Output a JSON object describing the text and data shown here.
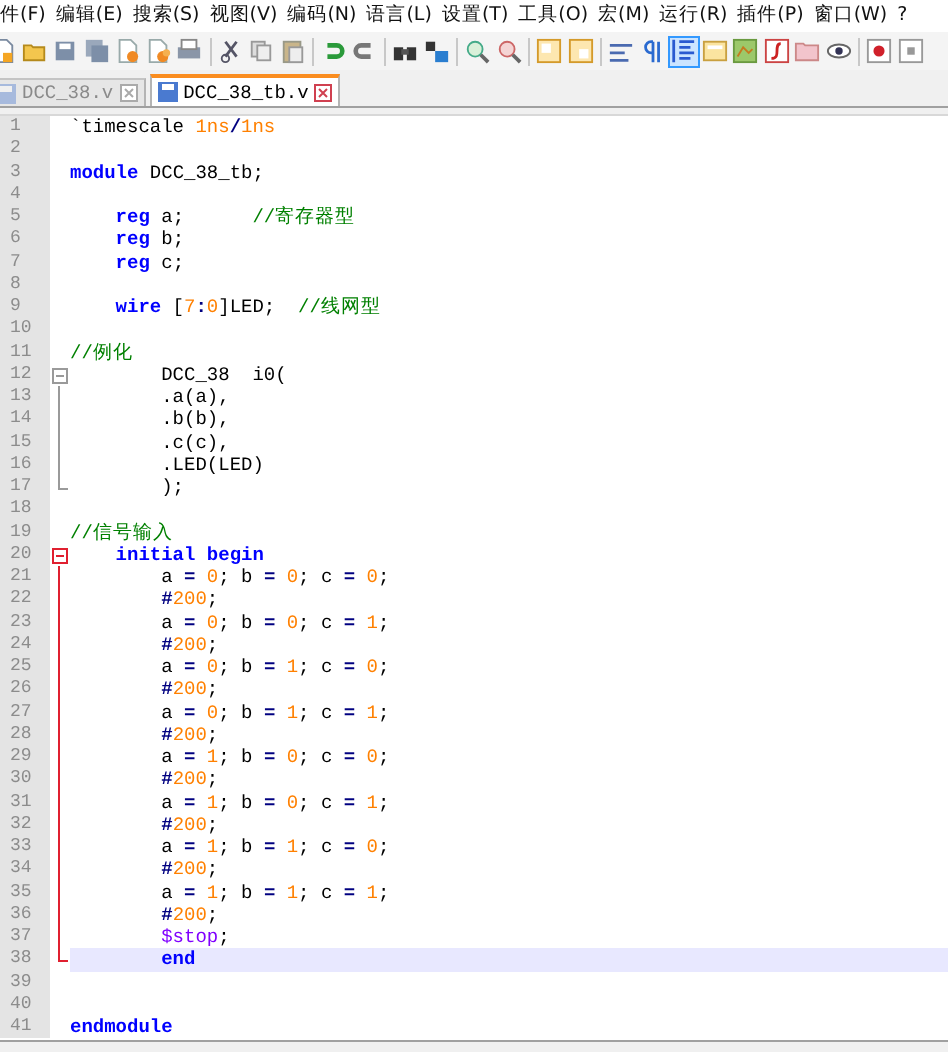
{
  "menu": [
    {
      "label": "件(F)"
    },
    {
      "label": "编辑(E)"
    },
    {
      "label": "搜索(S)"
    },
    {
      "label": "视图(V)"
    },
    {
      "label": "编码(N)"
    },
    {
      "label": "语言(L)"
    },
    {
      "label": "设置(T)"
    },
    {
      "label": "工具(O)"
    },
    {
      "label": "宏(M)"
    },
    {
      "label": "运行(R)"
    },
    {
      "label": "插件(P)"
    },
    {
      "label": "窗口(W)"
    },
    {
      "label": "?"
    }
  ],
  "toolbar": [
    {
      "kind": "new",
      "pressed": false
    },
    {
      "kind": "open",
      "pressed": false
    },
    {
      "kind": "save",
      "pressed": false
    },
    {
      "kind": "saveall",
      "pressed": false
    },
    {
      "kind": "close",
      "pressed": false
    },
    {
      "kind": "closeall",
      "pressed": false
    },
    {
      "kind": "print",
      "pressed": false
    },
    {
      "kind": "sep"
    },
    {
      "kind": "cut",
      "pressed": false
    },
    {
      "kind": "copy",
      "pressed": false
    },
    {
      "kind": "paste",
      "pressed": false
    },
    {
      "kind": "sep"
    },
    {
      "kind": "undo",
      "pressed": false
    },
    {
      "kind": "redo",
      "pressed": false
    },
    {
      "kind": "sep"
    },
    {
      "kind": "find",
      "pressed": false
    },
    {
      "kind": "replace",
      "pressed": false
    },
    {
      "kind": "sep"
    },
    {
      "kind": "zoomin",
      "pressed": false
    },
    {
      "kind": "zoomout",
      "pressed": false
    },
    {
      "kind": "sep"
    },
    {
      "kind": "syncv",
      "pressed": false
    },
    {
      "kind": "synch",
      "pressed": false
    },
    {
      "kind": "sep"
    },
    {
      "kind": "wrap",
      "pressed": false
    },
    {
      "kind": "pilcrow",
      "pressed": false
    },
    {
      "kind": "guide",
      "pressed": true
    },
    {
      "kind": "panel",
      "pressed": false
    },
    {
      "kind": "map",
      "pressed": false
    },
    {
      "kind": "function",
      "pressed": false
    },
    {
      "kind": "folder",
      "pressed": false
    },
    {
      "kind": "eye",
      "pressed": false
    },
    {
      "kind": "sep"
    },
    {
      "kind": "record",
      "pressed": false
    },
    {
      "kind": "stop",
      "pressed": false
    }
  ],
  "tabs": [
    {
      "label": "DCC_38.v",
      "selected": false
    },
    {
      "label": "DCC_38_tb.v",
      "selected": true
    }
  ],
  "editor": {
    "lines": [
      {
        "number": "1",
        "current": false,
        "tokens": [
          {
            "text": "`timescale ",
            "kind": "plain"
          },
          {
            "text": "1ns",
            "kind": "number"
          },
          {
            "text": "/",
            "kind": "operator"
          },
          {
            "text": "1ns",
            "kind": "number"
          }
        ]
      },
      {
        "number": "2",
        "current": false
      },
      {
        "number": "3",
        "current": false,
        "tokens": [
          {
            "text": "module",
            "kind": "keyword"
          },
          {
            "text": " DCC_38_tb;",
            "kind": "plain"
          }
        ]
      },
      {
        "number": "4",
        "current": false
      },
      {
        "number": "5",
        "current": false,
        "tokens": [
          {
            "text": "    reg",
            "kind": "keyword"
          },
          {
            "text": " a;      ",
            "kind": "plain"
          },
          {
            "text": "//寄存器型",
            "kind": "comment"
          }
        ]
      },
      {
        "number": "6",
        "current": false,
        "tokens": [
          {
            "text": "    reg",
            "kind": "keyword"
          },
          {
            "text": " b;",
            "kind": "plain"
          }
        ]
      },
      {
        "number": "7",
        "current": false,
        "tokens": [
          {
            "text": "    reg",
            "kind": "keyword"
          },
          {
            "text": " c;",
            "kind": "plain"
          }
        ]
      },
      {
        "number": "8",
        "current": false
      },
      {
        "number": "9",
        "current": false,
        "tokens": [
          {
            "text": "    wire",
            "kind": "keyword"
          },
          {
            "text": " [",
            "kind": "plain"
          },
          {
            "text": "7",
            "kind": "number"
          },
          {
            "text": ":",
            "kind": "operator"
          },
          {
            "text": "0",
            "kind": "number"
          },
          {
            "text": "]LED;  ",
            "kind": "plain"
          },
          {
            "text": "//线网型",
            "kind": "comment"
          }
        ]
      },
      {
        "number": "10",
        "current": false
      },
      {
        "number": "11",
        "current": false,
        "tokens": [
          {
            "text": "//例化",
            "kind": "comment"
          }
        ]
      },
      {
        "number": "12",
        "current": false,
        "fold": {
          "kind": "open",
          "active": false
        },
        "tokens": [
          {
            "text": "        DCC_38  i0(",
            "kind": "plain"
          }
        ]
      },
      {
        "number": "13",
        "current": false,
        "fold": {
          "kind": "body",
          "active": false
        },
        "tokens": [
          {
            "text": "        .a(a),",
            "kind": "plain"
          }
        ]
      },
      {
        "number": "14",
        "current": false,
        "fold": {
          "kind": "body",
          "active": false
        },
        "tokens": [
          {
            "text": "        .b(b),",
            "kind": "plain"
          }
        ]
      },
      {
        "number": "15",
        "current": false,
        "fold": {
          "kind": "body",
          "active": false
        },
        "tokens": [
          {
            "text": "        .c(c),",
            "kind": "plain"
          }
        ]
      },
      {
        "number": "16",
        "current": false,
        "fold": {
          "kind": "body",
          "active": false
        },
        "tokens": [
          {
            "text": "        .LED(LED)",
            "kind": "plain"
          }
        ]
      },
      {
        "number": "17",
        "current": false,
        "fold": {
          "kind": "end",
          "active": false
        },
        "tokens": [
          {
            "text": "        );",
            "kind": "plain"
          }
        ]
      },
      {
        "number": "18",
        "current": false
      },
      {
        "number": "19",
        "current": false,
        "tokens": [
          {
            "text": "//信号输入",
            "kind": "comment"
          }
        ]
      },
      {
        "number": "20",
        "current": false,
        "fold": {
          "kind": "open",
          "active": true
        },
        "tokens": [
          {
            "text": "    initial begin",
            "kind": "keyword"
          }
        ]
      },
      {
        "number": "21",
        "current": false,
        "fold": {
          "kind": "body",
          "active": true
        },
        "tokens": [
          {
            "text": "        a ",
            "kind": "plain"
          },
          {
            "text": "=",
            "kind": "operator"
          },
          {
            "text": " 0",
            "kind": "number"
          },
          {
            "text": "; b ",
            "kind": "plain"
          },
          {
            "text": "=",
            "kind": "operator"
          },
          {
            "text": " 0",
            "kind": "number"
          },
          {
            "text": "; c ",
            "kind": "plain"
          },
          {
            "text": "=",
            "kind": "operator"
          },
          {
            "text": " 0",
            "kind": "number"
          },
          {
            "text": ";",
            "kind": "plain"
          }
        ]
      },
      {
        "number": "22",
        "current": false,
        "fold": {
          "kind": "body",
          "active": true
        },
        "tokens": [
          {
            "text": "        #",
            "kind": "operator"
          },
          {
            "text": "200",
            "kind": "number"
          },
          {
            "text": ";",
            "kind": "plain"
          }
        ]
      },
      {
        "number": "23",
        "current": false,
        "fold": {
          "kind": "body",
          "active": true
        },
        "tokens": [
          {
            "text": "        a ",
            "kind": "plain"
          },
          {
            "text": "=",
            "kind": "operator"
          },
          {
            "text": " 0",
            "kind": "number"
          },
          {
            "text": "; b ",
            "kind": "plain"
          },
          {
            "text": "=",
            "kind": "operator"
          },
          {
            "text": " 0",
            "kind": "number"
          },
          {
            "text": "; c ",
            "kind": "plain"
          },
          {
            "text": "=",
            "kind": "operator"
          },
          {
            "text": " 1",
            "kind": "number"
          },
          {
            "text": ";",
            "kind": "plain"
          }
        ]
      },
      {
        "number": "24",
        "current": false,
        "fold": {
          "kind": "body",
          "active": true
        },
        "tokens": [
          {
            "text": "        #",
            "kind": "operator"
          },
          {
            "text": "200",
            "kind": "number"
          },
          {
            "text": ";",
            "kind": "plain"
          }
        ]
      },
      {
        "number": "25",
        "current": false,
        "fold": {
          "kind": "body",
          "active": true
        },
        "tokens": [
          {
            "text": "        a ",
            "kind": "plain"
          },
          {
            "text": "=",
            "kind": "operator"
          },
          {
            "text": " 0",
            "kind": "number"
          },
          {
            "text": "; b ",
            "kind": "plain"
          },
          {
            "text": "=",
            "kind": "operator"
          },
          {
            "text": " 1",
            "kind": "number"
          },
          {
            "text": "; c ",
            "kind": "plain"
          },
          {
            "text": "=",
            "kind": "operator"
          },
          {
            "text": " 0",
            "kind": "number"
          },
          {
            "text": ";",
            "kind": "plain"
          }
        ]
      },
      {
        "number": "26",
        "current": false,
        "fold": {
          "kind": "body",
          "active": true
        },
        "tokens": [
          {
            "text": "        #",
            "kind": "operator"
          },
          {
            "text": "200",
            "kind": "number"
          },
          {
            "text": ";",
            "kind": "plain"
          }
        ]
      },
      {
        "number": "27",
        "current": false,
        "fold": {
          "kind": "body",
          "active": true
        },
        "tokens": [
          {
            "text": "        a ",
            "kind": "plain"
          },
          {
            "text": "=",
            "kind": "operator"
          },
          {
            "text": " 0",
            "kind": "number"
          },
          {
            "text": "; b ",
            "kind": "plain"
          },
          {
            "text": "=",
            "kind": "operator"
          },
          {
            "text": " 1",
            "kind": "number"
          },
          {
            "text": "; c ",
            "kind": "plain"
          },
          {
            "text": "=",
            "kind": "operator"
          },
          {
            "text": " 1",
            "kind": "number"
          },
          {
            "text": ";",
            "kind": "plain"
          }
        ]
      },
      {
        "number": "28",
        "current": false,
        "fold": {
          "kind": "body",
          "active": true
        },
        "tokens": [
          {
            "text": "        #",
            "kind": "operator"
          },
          {
            "text": "200",
            "kind": "number"
          },
          {
            "text": ";",
            "kind": "plain"
          }
        ]
      },
      {
        "number": "29",
        "current": false,
        "fold": {
          "kind": "body",
          "active": true
        },
        "tokens": [
          {
            "text": "        a ",
            "kind": "plain"
          },
          {
            "text": "=",
            "kind": "operator"
          },
          {
            "text": " 1",
            "kind": "number"
          },
          {
            "text": "; b ",
            "kind": "plain"
          },
          {
            "text": "=",
            "kind": "operator"
          },
          {
            "text": " 0",
            "kind": "number"
          },
          {
            "text": "; c ",
            "kind": "plain"
          },
          {
            "text": "=",
            "kind": "operator"
          },
          {
            "text": " 0",
            "kind": "number"
          },
          {
            "text": ";",
            "kind": "plain"
          }
        ]
      },
      {
        "number": "30",
        "current": false,
        "fold": {
          "kind": "body",
          "active": true
        },
        "tokens": [
          {
            "text": "        #",
            "kind": "operator"
          },
          {
            "text": "200",
            "kind": "number"
          },
          {
            "text": ";",
            "kind": "plain"
          }
        ]
      },
      {
        "number": "31",
        "current": false,
        "fold": {
          "kind": "body",
          "active": true
        },
        "tokens": [
          {
            "text": "        a ",
            "kind": "plain"
          },
          {
            "text": "=",
            "kind": "operator"
          },
          {
            "text": " 1",
            "kind": "number"
          },
          {
            "text": "; b ",
            "kind": "plain"
          },
          {
            "text": "=",
            "kind": "operator"
          },
          {
            "text": " 0",
            "kind": "number"
          },
          {
            "text": "; c ",
            "kind": "plain"
          },
          {
            "text": "=",
            "kind": "operator"
          },
          {
            "text": " 1",
            "kind": "number"
          },
          {
            "text": ";",
            "kind": "plain"
          }
        ]
      },
      {
        "number": "32",
        "current": false,
        "fold": {
          "kind": "body",
          "active": true
        },
        "tokens": [
          {
            "text": "        #",
            "kind": "operator"
          },
          {
            "text": "200",
            "kind": "number"
          },
          {
            "text": ";",
            "kind": "plain"
          }
        ]
      },
      {
        "number": "33",
        "current": false,
        "fold": {
          "kind": "body",
          "active": true
        },
        "tokens": [
          {
            "text": "        a ",
            "kind": "plain"
          },
          {
            "text": "=",
            "kind": "operator"
          },
          {
            "text": " 1",
            "kind": "number"
          },
          {
            "text": "; b ",
            "kind": "plain"
          },
          {
            "text": "=",
            "kind": "operator"
          },
          {
            "text": " 1",
            "kind": "number"
          },
          {
            "text": "; c ",
            "kind": "plain"
          },
          {
            "text": "=",
            "kind": "operator"
          },
          {
            "text": " 0",
            "kind": "number"
          },
          {
            "text": ";",
            "kind": "plain"
          }
        ]
      },
      {
        "number": "34",
        "current": false,
        "fold": {
          "kind": "body",
          "active": true
        },
        "tokens": [
          {
            "text": "        #",
            "kind": "operator"
          },
          {
            "text": "200",
            "kind": "number"
          },
          {
            "text": ";",
            "kind": "plain"
          }
        ]
      },
      {
        "number": "35",
        "current": false,
        "fold": {
          "kind": "body",
          "active": true
        },
        "tokens": [
          {
            "text": "        a ",
            "kind": "plain"
          },
          {
            "text": "=",
            "kind": "operator"
          },
          {
            "text": " 1",
            "kind": "number"
          },
          {
            "text": "; b ",
            "kind": "plain"
          },
          {
            "text": "=",
            "kind": "operator"
          },
          {
            "text": " 1",
            "kind": "number"
          },
          {
            "text": "; c ",
            "kind": "plain"
          },
          {
            "text": "=",
            "kind": "operator"
          },
          {
            "text": " 1",
            "kind": "number"
          },
          {
            "text": ";",
            "kind": "plain"
          }
        ]
      },
      {
        "number": "36",
        "current": false,
        "fold": {
          "kind": "body",
          "active": true
        },
        "tokens": [
          {
            "text": "        #",
            "kind": "operator"
          },
          {
            "text": "200",
            "kind": "number"
          },
          {
            "text": ";",
            "kind": "plain"
          }
        ]
      },
      {
        "number": "37",
        "current": false,
        "fold": {
          "kind": "body",
          "active": true
        },
        "tokens": [
          {
            "text": "        $stop",
            "kind": "system"
          },
          {
            "text": ";",
            "kind": "plain"
          }
        ]
      },
      {
        "number": "38",
        "current": true,
        "fold": {
          "kind": "end",
          "active": true
        },
        "tokens": [
          {
            "text": "        end",
            "kind": "keyword"
          }
        ]
      },
      {
        "number": "39",
        "current": false
      },
      {
        "number": "40",
        "current": false
      },
      {
        "number": "41",
        "current": false,
        "tokens": [
          {
            "text": "endmodule",
            "kind": "keyword"
          }
        ]
      }
    ]
  }
}
